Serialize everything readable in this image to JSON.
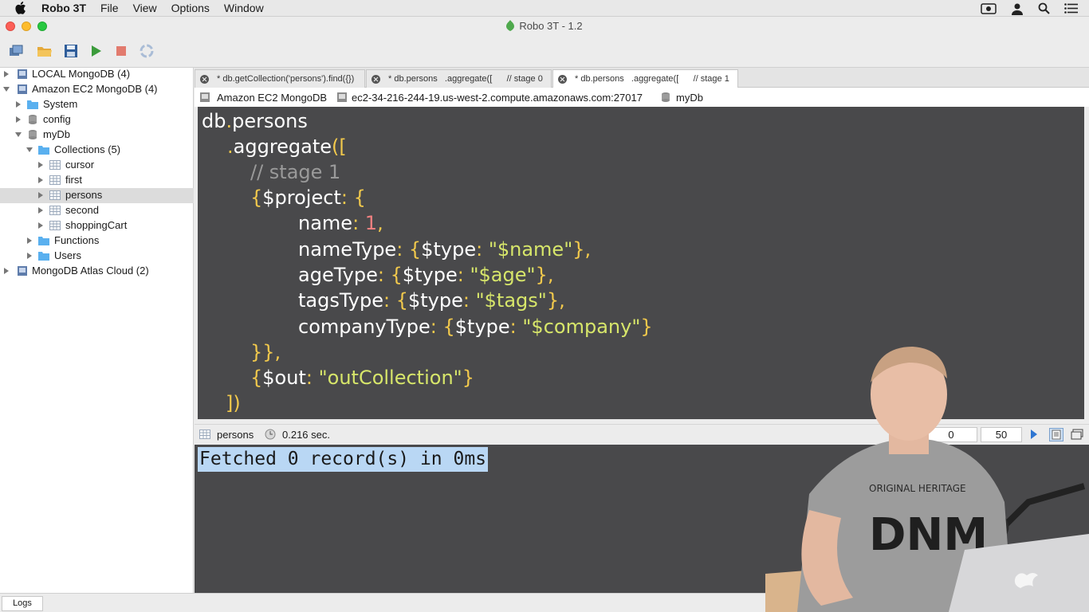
{
  "menubar": {
    "app_name": "Robo 3T",
    "items": [
      "File",
      "View",
      "Options",
      "Window"
    ],
    "right_icons": [
      "camera-icon",
      "user-icon",
      "search-icon",
      "list-icon"
    ]
  },
  "window": {
    "title": "Robo 3T - 1.2"
  },
  "toolbar": {
    "buttons": [
      "connect-icon",
      "open-folder-icon",
      "save-icon",
      "run-icon",
      "stop-icon",
      "rotate-icon"
    ]
  },
  "sidebar": {
    "items": [
      {
        "label": "LOCAL MongoDB (4)",
        "icon": "server-icon"
      },
      {
        "label": "Amazon EC2 MongoDB (4)",
        "icon": "server-icon"
      },
      {
        "label": "System",
        "icon": "folder-icon"
      },
      {
        "label": "config",
        "icon": "database-icon"
      },
      {
        "label": "myDb",
        "icon": "database-icon"
      },
      {
        "label": "Collections (5)",
        "icon": "folder-icon"
      },
      {
        "label": "cursor",
        "icon": "table-icon"
      },
      {
        "label": "first",
        "icon": "table-icon"
      },
      {
        "label": "persons",
        "icon": "table-icon"
      },
      {
        "label": "second",
        "icon": "table-icon"
      },
      {
        "label": "shoppingCart",
        "icon": "table-icon"
      },
      {
        "label": "Functions",
        "icon": "folder-icon"
      },
      {
        "label": "Users",
        "icon": "folder-icon"
      },
      {
        "label": "MongoDB Atlas Cloud (2)",
        "icon": "server-icon"
      }
    ]
  },
  "tabs": [
    {
      "label": "* db.getCollection('persons').find({})"
    },
    {
      "label": "* db.persons   .aggregate([      // stage 0"
    },
    {
      "label": "* db.persons   .aggregate([      // stage 1"
    }
  ],
  "connection": {
    "server": "Amazon EC2 MongoDB",
    "host": "ec2-34-216-244-19.us-west-2.compute.amazonaws.com:27017",
    "database": "myDb"
  },
  "editor": {
    "code": {
      "l1_obj": "db",
      "l1_dot": ".",
      "l1_name": "persons",
      "l2_dot": ".",
      "l2_fn": "aggregate",
      "l2_open": "([",
      "l3_comment": "// stage 1",
      "l4_open": "{",
      "l4_key": "$project",
      "l4_colon": ":",
      "l4_brace": "{",
      "l5_key": "name",
      "l5_colon": ":",
      "l5_val": "1",
      "l5_comma": ",",
      "l6_key": "nameType",
      "l6_colon": ":",
      "l6_open": "{",
      "l6_inner": "$type",
      "l6_c2": ":",
      "l6_str": "\"$name\"",
      "l6_close": "},",
      "l7_key": "ageType",
      "l7_colon": ":",
      "l7_open": "{",
      "l7_inner": "$type",
      "l7_c2": ":",
      "l7_str": "\"$age\"",
      "l7_close": "},",
      "l8_key": "tagsType",
      "l8_colon": ":",
      "l8_open": "{",
      "l8_inner": "$type",
      "l8_c2": ":",
      "l8_str": "\"$tags\"",
      "l8_close": "},",
      "l9_key": "companyType",
      "l9_colon": ":",
      "l9_open": "{",
      "l9_inner": "$type",
      "l9_c2": ":",
      "l9_str": "\"$company\"",
      "l9_close": "}",
      "l10_close": "}},",
      "l11_open": "{",
      "l11_key": "$out",
      "l11_colon": ":",
      "l11_str": "\"outCollection\"",
      "l11_close": "}",
      "l12_close": "])"
    }
  },
  "status": {
    "collection": "persons",
    "time": "0.216 sec.",
    "page_start": "0",
    "page_size": "50"
  },
  "output": {
    "message": "Fetched 0 record(s) in 0ms"
  },
  "bottom": {
    "logs_label": "Logs"
  },
  "presenter": {
    "shirt_line1": "ORIGINAL HERITAGE",
    "shirt_line2": "DNM"
  },
  "colors": {
    "editor_bg": "#49494b",
    "string": "#d7e66a",
    "bracket": "#f2c94c",
    "number": "#f08080",
    "comment": "#9a9a9a",
    "selection": "#b9d7f4"
  }
}
